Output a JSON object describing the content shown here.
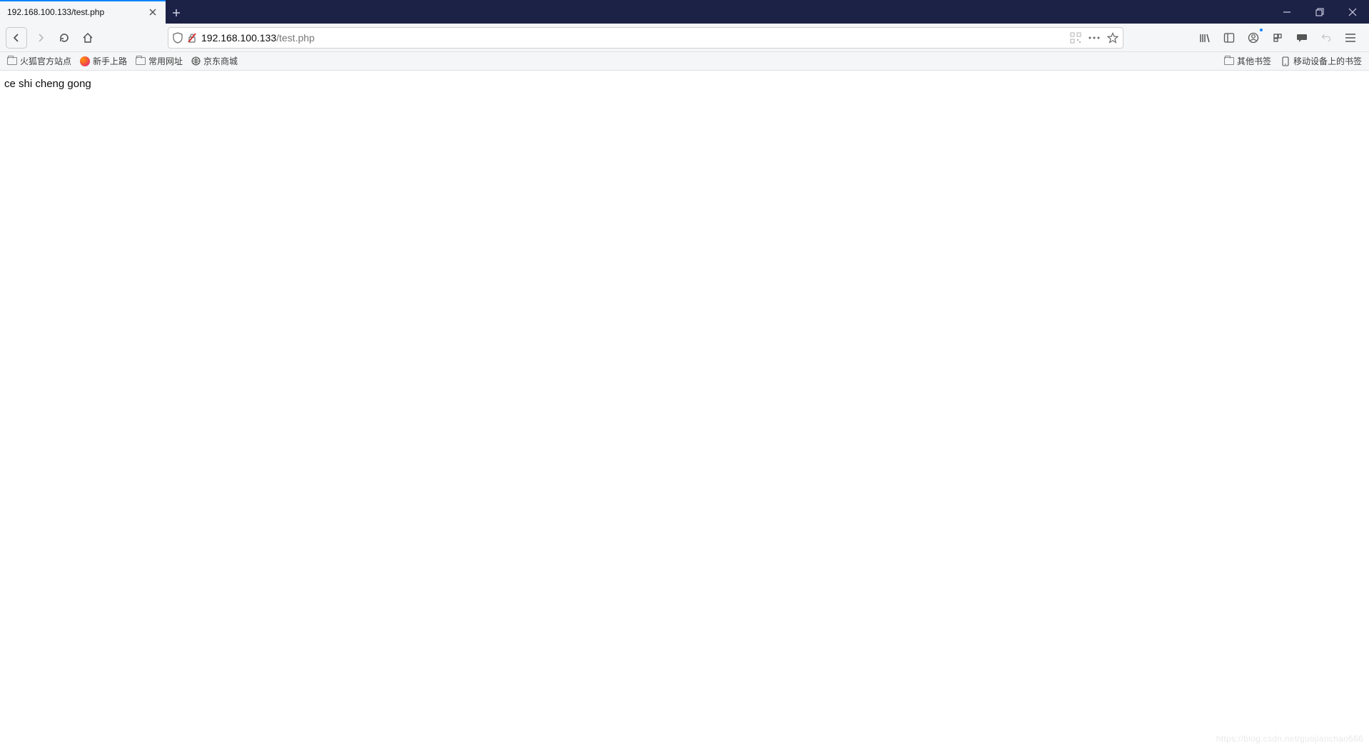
{
  "tab": {
    "title": "192.168.100.133/test.php"
  },
  "url": {
    "host": "192.168.100.133",
    "path": "/test.php"
  },
  "bookmarks": {
    "left": [
      {
        "kind": "folder",
        "label": "火狐官方站点"
      },
      {
        "kind": "fx",
        "label": "新手上路"
      },
      {
        "kind": "folder",
        "label": "常用网址"
      },
      {
        "kind": "globe",
        "label": "京东商城"
      }
    ],
    "right": [
      {
        "kind": "folder",
        "label": "其他书签"
      },
      {
        "kind": "mobile",
        "label": "移动设备上的书签"
      }
    ]
  },
  "page": {
    "body_text": "ce shi cheng gong"
  },
  "watermark": "https://blog.csdn.net/guojianchao666"
}
